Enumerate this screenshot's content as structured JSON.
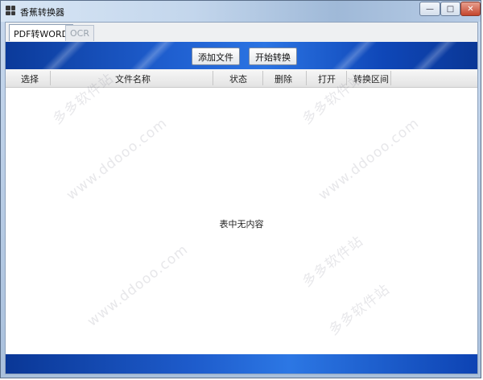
{
  "window": {
    "title": "香蕉转换器",
    "icons": {
      "app": "app-grid-icon",
      "minimize": "minimize-icon",
      "maximize": "maximize-icon",
      "close": "close-icon"
    },
    "minimize_glyph": "—",
    "maximize_glyph": "□",
    "close_glyph": "✕"
  },
  "tabs": [
    {
      "label": "PDF转WORD",
      "active": true
    },
    {
      "label": "OCR",
      "active": false
    }
  ],
  "toolbar": {
    "add_file_label": "添加文件",
    "start_convert_label": "开始转换"
  },
  "table": {
    "columns": [
      "选择",
      "文件名称",
      "状态",
      "删除",
      "打开",
      "转换区间"
    ],
    "empty_message": "表中无内容"
  },
  "watermarks": [
    "多多软件站",
    "www.ddooo.com",
    "多多软件站",
    "www.ddooo.com",
    "多多软件站",
    "www.ddooo.com",
    "多多软件站"
  ],
  "colors": {
    "toolbar_blue": "#1f5fd0",
    "titlebar": "#c3d6ec",
    "close_red": "#c5462e"
  }
}
